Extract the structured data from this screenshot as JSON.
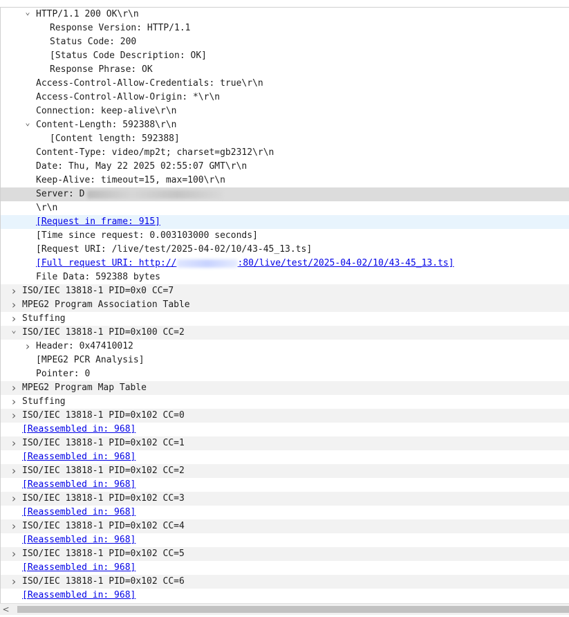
{
  "tree": {
    "rows": [
      {
        "t": "HTTP/1.1 200 OK\\r\\n",
        "toggle": "expanded",
        "lvl": 1,
        "bg": "none"
      },
      {
        "t": "Response Version: HTTP/1.1",
        "lvl": 2,
        "bg": "none"
      },
      {
        "t": "Status Code: 200",
        "lvl": 2,
        "bg": "none"
      },
      {
        "t": "[Status Code Description: OK]",
        "lvl": 2,
        "bg": "none"
      },
      {
        "t": "Response Phrase: OK",
        "lvl": 2,
        "bg": "none"
      },
      {
        "t": "Access-Control-Allow-Credentials: true\\r\\n",
        "lvl": 1,
        "bg": "none"
      },
      {
        "t": "Access-Control-Allow-Origin: *\\r\\n",
        "lvl": 1,
        "bg": "none"
      },
      {
        "t": "Connection: keep-alive\\r\\n",
        "lvl": 1,
        "bg": "none"
      },
      {
        "t": "Content-Length: 592388\\r\\n",
        "toggle": "expanded",
        "lvl": 1,
        "bg": "none"
      },
      {
        "t": "[Content length: 592388]",
        "lvl": 2,
        "bg": "none"
      },
      {
        "t": "Content-Type: video/mp2t; charset=gb2312\\r\\n",
        "lvl": 1,
        "bg": "none"
      },
      {
        "t": "Date: Thu, May 22 2025 02:55:07 GMT\\r\\n",
        "lvl": 1,
        "bg": "none"
      },
      {
        "t": "Keep-Alive: timeout=15, max=100\\r\\n",
        "lvl": 1,
        "bg": "none"
      },
      {
        "t": "Server: D",
        "lvl": 1,
        "bg": "sel",
        "redact": "dark"
      },
      {
        "t": "\\r\\n",
        "lvl": 1,
        "bg": "none"
      },
      {
        "t": "[Request in frame: 915]",
        "lvl": 1,
        "bg": "hover",
        "link": true
      },
      {
        "t": "[Time since request: 0.003103000 seconds]",
        "lvl": 1,
        "bg": "none"
      },
      {
        "t": "[Request URI: /live/test/2025-04-02/10/43-45_13.ts]",
        "lvl": 1,
        "bg": "none"
      },
      {
        "t": "[Full request URI: http://",
        "tail": ":80/live/test/2025-04-02/10/43-45_13.ts]",
        "lvl": 1,
        "bg": "none",
        "link": true,
        "redact": "light"
      },
      {
        "t": "File Data: 592388 bytes",
        "lvl": 1,
        "bg": "none"
      },
      {
        "t": "ISO/IEC 13818-1 PID=0x0 CC=7",
        "toggle": "collapsed",
        "lvl": 0,
        "bg": "alt"
      },
      {
        "t": "MPEG2 Program Association Table",
        "toggle": "collapsed",
        "lvl": 0,
        "bg": "alt"
      },
      {
        "t": "Stuffing",
        "toggle": "collapsed",
        "lvl": 0,
        "bg": "none"
      },
      {
        "t": "ISO/IEC 13818-1 PID=0x100 CC=2",
        "toggle": "expanded",
        "lvl": 0,
        "bg": "alt"
      },
      {
        "t": "Header: 0x47410012",
        "toggle": "collapsed",
        "lvl": 1,
        "bg": "none"
      },
      {
        "t": "[MPEG2 PCR Analysis]",
        "lvl": 1,
        "bg": "none"
      },
      {
        "t": "Pointer: 0",
        "lvl": 1,
        "bg": "none"
      },
      {
        "t": "MPEG2 Program Map Table",
        "toggle": "collapsed",
        "lvl": 0,
        "bg": "alt"
      },
      {
        "t": "Stuffing",
        "toggle": "collapsed",
        "lvl": 0,
        "bg": "none"
      },
      {
        "t": "ISO/IEC 13818-1 PID=0x102 CC=0",
        "toggle": "collapsed",
        "lvl": 0,
        "bg": "alt"
      },
      {
        "t": "[Reassembled in: 968]",
        "lvl": 0,
        "bg": "none",
        "link": true
      },
      {
        "t": "ISO/IEC 13818-1 PID=0x102 CC=1",
        "toggle": "collapsed",
        "lvl": 0,
        "bg": "alt"
      },
      {
        "t": "[Reassembled in: 968]",
        "lvl": 0,
        "bg": "none",
        "link": true
      },
      {
        "t": "ISO/IEC 13818-1 PID=0x102 CC=2",
        "toggle": "collapsed",
        "lvl": 0,
        "bg": "alt"
      },
      {
        "t": "[Reassembled in: 968]",
        "lvl": 0,
        "bg": "none",
        "link": true
      },
      {
        "t": "ISO/IEC 13818-1 PID=0x102 CC=3",
        "toggle": "collapsed",
        "lvl": 0,
        "bg": "alt"
      },
      {
        "t": "[Reassembled in: 968]",
        "lvl": 0,
        "bg": "none",
        "link": true
      },
      {
        "t": "ISO/IEC 13818-1 PID=0x102 CC=4",
        "toggle": "collapsed",
        "lvl": 0,
        "bg": "alt"
      },
      {
        "t": "[Reassembled in: 968]",
        "lvl": 0,
        "bg": "none",
        "link": true
      },
      {
        "t": "ISO/IEC 13818-1 PID=0x102 CC=5",
        "toggle": "collapsed",
        "lvl": 0,
        "bg": "alt"
      },
      {
        "t": "[Reassembled in: 968]",
        "lvl": 0,
        "bg": "none",
        "link": true
      },
      {
        "t": "ISO/IEC 13818-1 PID=0x102 CC=6",
        "toggle": "collapsed",
        "lvl": 0,
        "bg": "alt"
      },
      {
        "t": "[Reassembled in: 968]",
        "lvl": 0,
        "bg": "none",
        "link": true
      }
    ]
  },
  "scrollbar": {
    "left_arrow_icon": "chevron-left-icon",
    "left_arrow_glyph": "<"
  },
  "colors": {
    "link": "#0000e6",
    "selected_row": "#dcdcdc",
    "alt_row": "#f2f2f2",
    "hover_row": "#e8f4fd"
  }
}
